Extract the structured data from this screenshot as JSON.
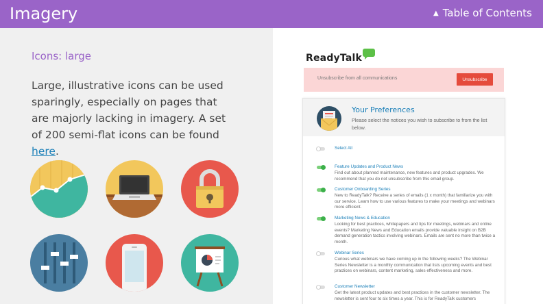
{
  "header": {
    "title": "Imagery",
    "toc_label": "Table of Contents"
  },
  "left": {
    "subhead": "Icons: large",
    "body_text": "Large, illustrative icons can be used sparingly, especially on pages that are majorly lacking in imagery. A set of 200 semi-flat icons can be found ",
    "link_text": "here",
    "body_end": ".",
    "icons": [
      "line-chart-icon",
      "laptop-icon",
      "padlock-icon",
      "sliders-icon",
      "smartphone-icon",
      "presentation-board-icon"
    ]
  },
  "email": {
    "logo_text": "ReadyTalk",
    "unsubscribe_label": "Unsubscribe from all communications",
    "unsubscribe_button": "Unsubscribe",
    "prefs_title": "Your Preferences",
    "prefs_desc": "Please select the notices you wish to subscribe to from the list below.",
    "options": [
      {
        "title": "Select All",
        "text": "",
        "on": false
      },
      {
        "title": "Feature Updates and Product News",
        "text": "Find out about planned maintenance, new features and product upgrades. We recommend that you do not unsubscribe from this email group.",
        "on": true
      },
      {
        "title": "Customer Onboarding Series",
        "text": "New to ReadyTalk? Receive a series of emails (1 x month) that familiarize you with our service. Learn how to use various features to make your meetings and webinars more efficient.",
        "on": true
      },
      {
        "title": "Marketing News & Education",
        "text": "Looking for best practices, whitepapers and tips for meetings, webinars and online events? Marketing News and Education emails provide valuable insight on B2B demand generation tactics involving webinars. Emails are sent no more than twice a month.",
        "on": true
      },
      {
        "title": "Webinar Series",
        "text": "Curious what webinars we have coming up in the following weeks? The Webinar Series Newsletter is a monthly communication that lists upcoming events and best practices on webinars, content marketing, sales effectiveness and more.",
        "on": false
      },
      {
        "title": "Customer Newsletter",
        "text": "Get the latest product updates and best practices in the customer newsletter. The newsletter is sent four to six times a year. This is for ReadyTalk customers",
        "on": false
      }
    ]
  }
}
